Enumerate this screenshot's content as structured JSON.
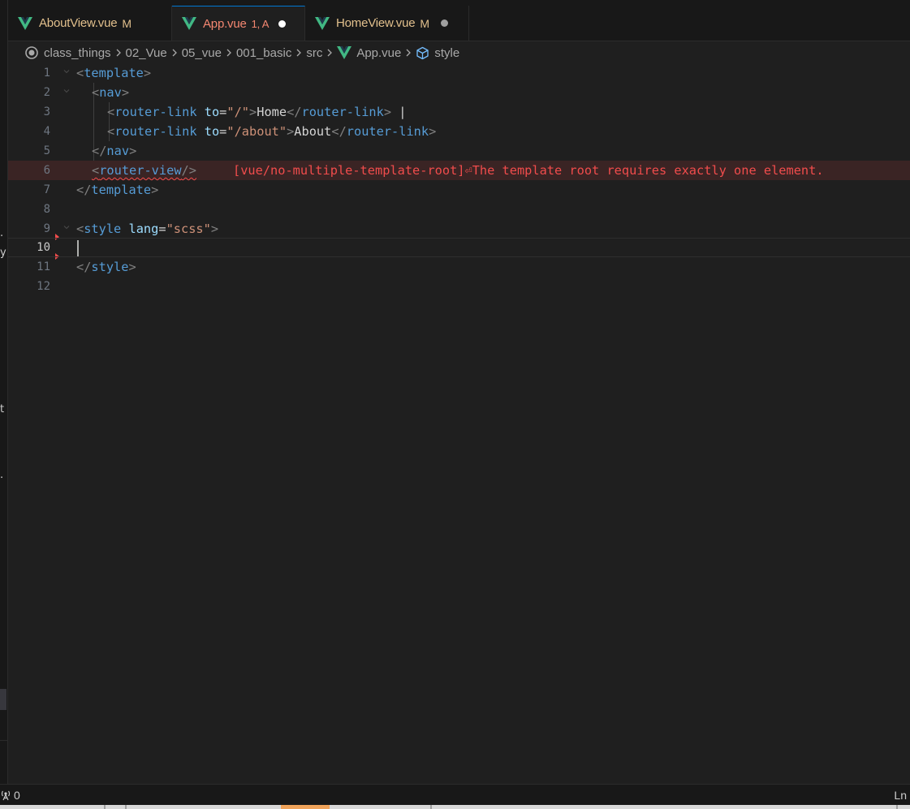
{
  "tabs": [
    {
      "name": "AboutView.vue",
      "flag": "M",
      "modified_dot": false,
      "active": false
    },
    {
      "name": "App.vue",
      "flag": "1, A",
      "modified_dot": true,
      "active": true
    },
    {
      "name": "HomeView.vue",
      "flag": "M",
      "modified_dot": true,
      "active": false
    }
  ],
  "breadcrumb": {
    "segments": [
      "class_things",
      "02_Vue",
      "05_vue",
      "001_basic",
      "src",
      "App.vue",
      "style"
    ],
    "icons": [
      "circle-icon",
      "vue-logo-icon",
      "cube-icon"
    ]
  },
  "editor": {
    "line_numbers": [
      "1",
      "2",
      "3",
      "4",
      "5",
      "6",
      "7",
      "8",
      "9",
      "10",
      "11",
      "12"
    ],
    "current_line": "10",
    "code": {
      "l1": {
        "open": "<",
        "tag": "template",
        "close": ">"
      },
      "l2": {
        "open": "<",
        "tag": "nav",
        "close": ">"
      },
      "l3": {
        "open": "<",
        "tag": "router-link",
        "attr": "to",
        "eq": "=",
        "val": "\"/\"",
        "close": ">",
        "text": "Home",
        "end_open": "</",
        "end_tag": "router-link",
        "end_close": ">",
        "trail": " |"
      },
      "l4": {
        "open": "<",
        "tag": "router-link",
        "attr": "to",
        "eq": "=",
        "val": "\"/about\"",
        "close": ">",
        "text": "About",
        "end_open": "</",
        "end_tag": "router-link",
        "end_close": ">"
      },
      "l5": {
        "open": "</",
        "tag": "nav",
        "close": ">"
      },
      "l6": {
        "open": "<",
        "tag": "router-view",
        "close": "/>"
      },
      "l7": {
        "open": "</",
        "tag": "template",
        "close": ">"
      },
      "l9": {
        "open": "<",
        "tag": "style",
        "attr": "lang",
        "eq": "=",
        "val": "\"scss\"",
        "close": ">"
      },
      "l11": {
        "open": "</",
        "tag": "style",
        "close": ">"
      }
    },
    "diagnostic": "[vue/no-multiple-template-root]⏎The template root requires exactly one element."
  },
  "left_strip_chars": [
    ".",
    "y",
    "t",
    "."
  ],
  "status": {
    "left_icon": "broadcast-icon",
    "left_value": "0",
    "right_text": "Ln"
  },
  "colors": {
    "accent": "#0078d4",
    "error": "#f14c4c",
    "modified": "#e2c08d",
    "vue_green": "#41b883"
  }
}
